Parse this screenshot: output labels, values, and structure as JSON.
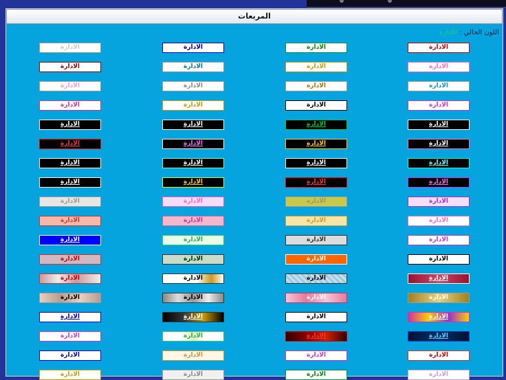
{
  "page_title": "المربعات",
  "current_color": {
    "label": "اللون الحالي :",
    "value": "الادارة"
  },
  "sample_text": "الادارة",
  "rows": [
    [
      {
        "bg": "#ffffff",
        "border": "#999999",
        "fg": "#c9c9c9"
      },
      {
        "bg": "#ffffff",
        "border": "#0000cc",
        "fg": "#000099"
      },
      {
        "bg": "#ffffff",
        "border": "#009933",
        "fg": "#008800"
      },
      {
        "bg": "#ffffff",
        "border": "#cc0000",
        "fg": "#cc0000"
      }
    ],
    [
      {
        "bg": "#ffffff",
        "border": "#990000",
        "fg": "#990000"
      },
      {
        "bg": "#ffffff",
        "border": "#999999",
        "fg": "#0077aa"
      },
      {
        "bg": "#ffffff",
        "border": "#cc9900",
        "fg": "#cc9900"
      },
      {
        "bg": "#ffffff",
        "border": "#ff66cc",
        "fg": "#ff66cc"
      }
    ],
    [
      {
        "bg": "#ffffff",
        "border": "#999999",
        "fg": "#ff99cc"
      },
      {
        "bg": "#ffffff",
        "border": "#999999",
        "fg": "#888888"
      },
      {
        "bg": "#ffffff",
        "border": "#999999",
        "fg": "#aa7700"
      },
      {
        "bg": "#ffffff",
        "border": "#999999",
        "fg": "#0099cc"
      }
    ],
    [
      {
        "bg": "#ffffff",
        "border": "#cc3399",
        "fg": "#cc3399"
      },
      {
        "bg": "#ffffff",
        "border": "#cc9900",
        "fg": "#cc9900"
      },
      {
        "bg": "#ffffff",
        "border": "#000000",
        "fg": "#000000"
      },
      {
        "bg": "#ffffff",
        "border": "#cc33cc",
        "fg": "#cc33cc"
      }
    ],
    [
      {
        "bg": "#000000",
        "border": "#ffffff",
        "fg": "#ffffff",
        "u": true
      },
      {
        "bg": "#000000",
        "border": "#ffffff",
        "fg": "#ffffff",
        "u": true
      },
      {
        "bg": "#000000",
        "border": "#00cc33",
        "fg": "#00cc33",
        "u": true
      },
      {
        "bg": "#000000",
        "border": "#ffffff",
        "fg": "#ffffff",
        "u": true
      }
    ],
    [
      {
        "bg": "#000000",
        "border": "#ff0000",
        "fg": "#ff3333",
        "u": true
      },
      {
        "bg": "#000000",
        "border": "#ffffff",
        "fg": "#ff66ff",
        "u": true
      },
      {
        "bg": "#000000",
        "border": "#ffcc00",
        "fg": "#ffcc00",
        "u": true
      },
      {
        "bg": "#000000",
        "border": "#ff66cc",
        "fg": "#ffffff",
        "u": true
      }
    ],
    [
      {
        "bg": "#000000",
        "border": "#ffffff",
        "fg": "#ffffff",
        "u": true
      },
      {
        "bg": "#000000",
        "border": "#66ffcc",
        "fg": "#ffffff",
        "u": true
      },
      {
        "bg": "#000000",
        "border": "#ffffff",
        "fg": "#ffffff",
        "u": true
      },
      {
        "bg": "#000000",
        "border": "#00ffcc",
        "fg": "#66ffff",
        "u": true
      }
    ],
    [
      {
        "bg": "#000000",
        "border": "#ffffff",
        "fg": "#ffffff",
        "u": true
      },
      {
        "bg": "#000000",
        "border": "#ccff00",
        "fg": "#ffcc00",
        "u": true
      },
      {
        "bg": "#000000",
        "border": "#ff0000",
        "fg": "#ff3333",
        "u": true
      },
      {
        "bg": "#000000",
        "border": "#cc33ff",
        "fg": "#ff66ff",
        "u": true
      }
    ],
    [
      {
        "bg": "#e6e6e6",
        "border": "#999999",
        "fg": "#999999"
      },
      {
        "bg": "#f5ddf5",
        "border": "#cc66cc",
        "fg": "#ff66cc"
      },
      {
        "bg": "#c8c84a",
        "border": "#999999",
        "fg": "#999966"
      },
      {
        "bg": "#f7ddfc",
        "border": "#9933cc",
        "fg": "#9933cc"
      }
    ],
    [
      {
        "bg": "#f4b9a8",
        "border": "#cc3333",
        "fg": "#cc3333"
      },
      {
        "bg": "#f2b8cc",
        "border": "#cc6699",
        "fg": "#cc3399"
      },
      {
        "bg": "#f8e6a8",
        "border": "#cc9933",
        "fg": "#cc9933"
      },
      {
        "bg": "#ffffff",
        "border": "#ff66cc",
        "fg": "#ff66cc"
      }
    ],
    [
      {
        "bg": "#0000ff",
        "border": "#ffffff",
        "fg": "#ffffff",
        "u": true
      },
      {
        "bg": "#e8ffe8",
        "border": "#33cc66",
        "fg": "#33aa55"
      },
      {
        "bg": "#dcdcdc",
        "border": "#333333",
        "fg": "#333333"
      },
      {
        "bg": "#ffffff",
        "border": "#cc33cc",
        "fg": "#cc33cc"
      }
    ],
    [
      {
        "bg": "#d0b8c0",
        "border": "#cc3333",
        "fg": "#cc0000"
      },
      {
        "bg": "#c8dcc8",
        "border": "#333333",
        "fg": "#003300"
      },
      {
        "bg": "#ff6600",
        "border": "#ffffff",
        "fg": "#ffffff"
      },
      {
        "bg": "#ffffff",
        "border": "#000000",
        "fg": "#000000"
      }
    ],
    [
      {
        "bg": "linear-gradient(90deg,#c99 0%,#eee 30%,#c99 60%,#eee 100%)",
        "border": "#cc3333",
        "fg": "#cc0000"
      },
      {
        "bg": "linear-gradient(90deg,#fff 0%,#fff 55%,#cc9922 80%,#fff 100%)",
        "border": "#333333",
        "fg": "#000000"
      },
      {
        "bg": "repeating-linear-gradient(45deg,#9cd 0px,#9cd 3px,#cde 3px,#cde 6px)",
        "border": "#333333",
        "fg": "#000000"
      },
      {
        "bg": "linear-gradient(90deg,#991133,#cc4466,#991133)",
        "border": "#ffffff",
        "fg": "#ffffff",
        "u": true
      }
    ],
    [
      {
        "bg": "linear-gradient(90deg,#e8d0c0,#b89c90,#e8d0c0,#b89c90)",
        "border": "#999999",
        "fg": "#000000"
      },
      {
        "bg": "linear-gradient(90deg,#888,#ddd,#999,#eee,#888)",
        "border": "#333333",
        "fg": "#000000"
      },
      {
        "bg": "linear-gradient(90deg,#f7c6d6,#e67a9a,#f7c6d6,#e67a9a)",
        "border": "#cc3366",
        "fg": "#ffffff"
      },
      {
        "bg": "linear-gradient(90deg,#a08020,#e8d080,#a08020)",
        "border": "#999999",
        "fg": "#ffffff"
      }
    ],
    [
      {
        "bg": "#ffffff",
        "border": "#0000cc",
        "fg": "#0000cc",
        "u": true
      },
      {
        "bg": "linear-gradient(90deg,#000,#333,#cc9900,#000)",
        "border": "#333333",
        "fg": "#ffffff",
        "u": true
      },
      {
        "bg": "#ffffff",
        "border": "#000000",
        "fg": "#000000"
      },
      {
        "bg": "linear-gradient(90deg,#cc3399,#ffcc00,#9933cc,#ffcc00)",
        "border": "#cc33cc",
        "fg": "#ffffff",
        "u": true
      }
    ],
    [
      {
        "bg": "#ffffff",
        "border": "#cc33cc",
        "fg": "#cc33cc"
      },
      {
        "bg": "linear-gradient(90deg,#fff,#fff 30%,#ddeebb 50%,#fff 70%)",
        "border": "#33cc66",
        "fg": "#33aa55"
      },
      {
        "bg": "linear-gradient(90deg,#330000,#880000,#cc2200,#330000)",
        "border": "#cc0000",
        "fg": "#ff3333",
        "u": true
      },
      {
        "bg": "linear-gradient(90deg,#001133,#003366,#001133)",
        "border": "#0033cc",
        "fg": "#66ccff",
        "u": true
      }
    ],
    [
      {
        "bg": "#ffffff",
        "border": "#0000cc",
        "fg": "#0000cc"
      },
      {
        "bg": "#fff6e8",
        "border": "#cc9933",
        "fg": "#cc9933"
      },
      {
        "bg": "#ffffff",
        "border": "#cc33cc",
        "fg": "#cc33cc"
      },
      {
        "bg": "#ffffff",
        "border": "#cc3333",
        "fg": "#cc0000"
      }
    ],
    [
      {
        "bg": "#ffffff",
        "border": "#cc9900",
        "fg": "#cc9900"
      },
      {
        "bg": "#f0f0f0",
        "border": "#999999",
        "fg": "#888888"
      },
      {
        "bg": "#ffffff",
        "border": "#009933",
        "fg": "#008800"
      },
      {
        "bg": "#ffffff",
        "border": "#cc99cc",
        "fg": "#cc99cc"
      }
    ]
  ]
}
